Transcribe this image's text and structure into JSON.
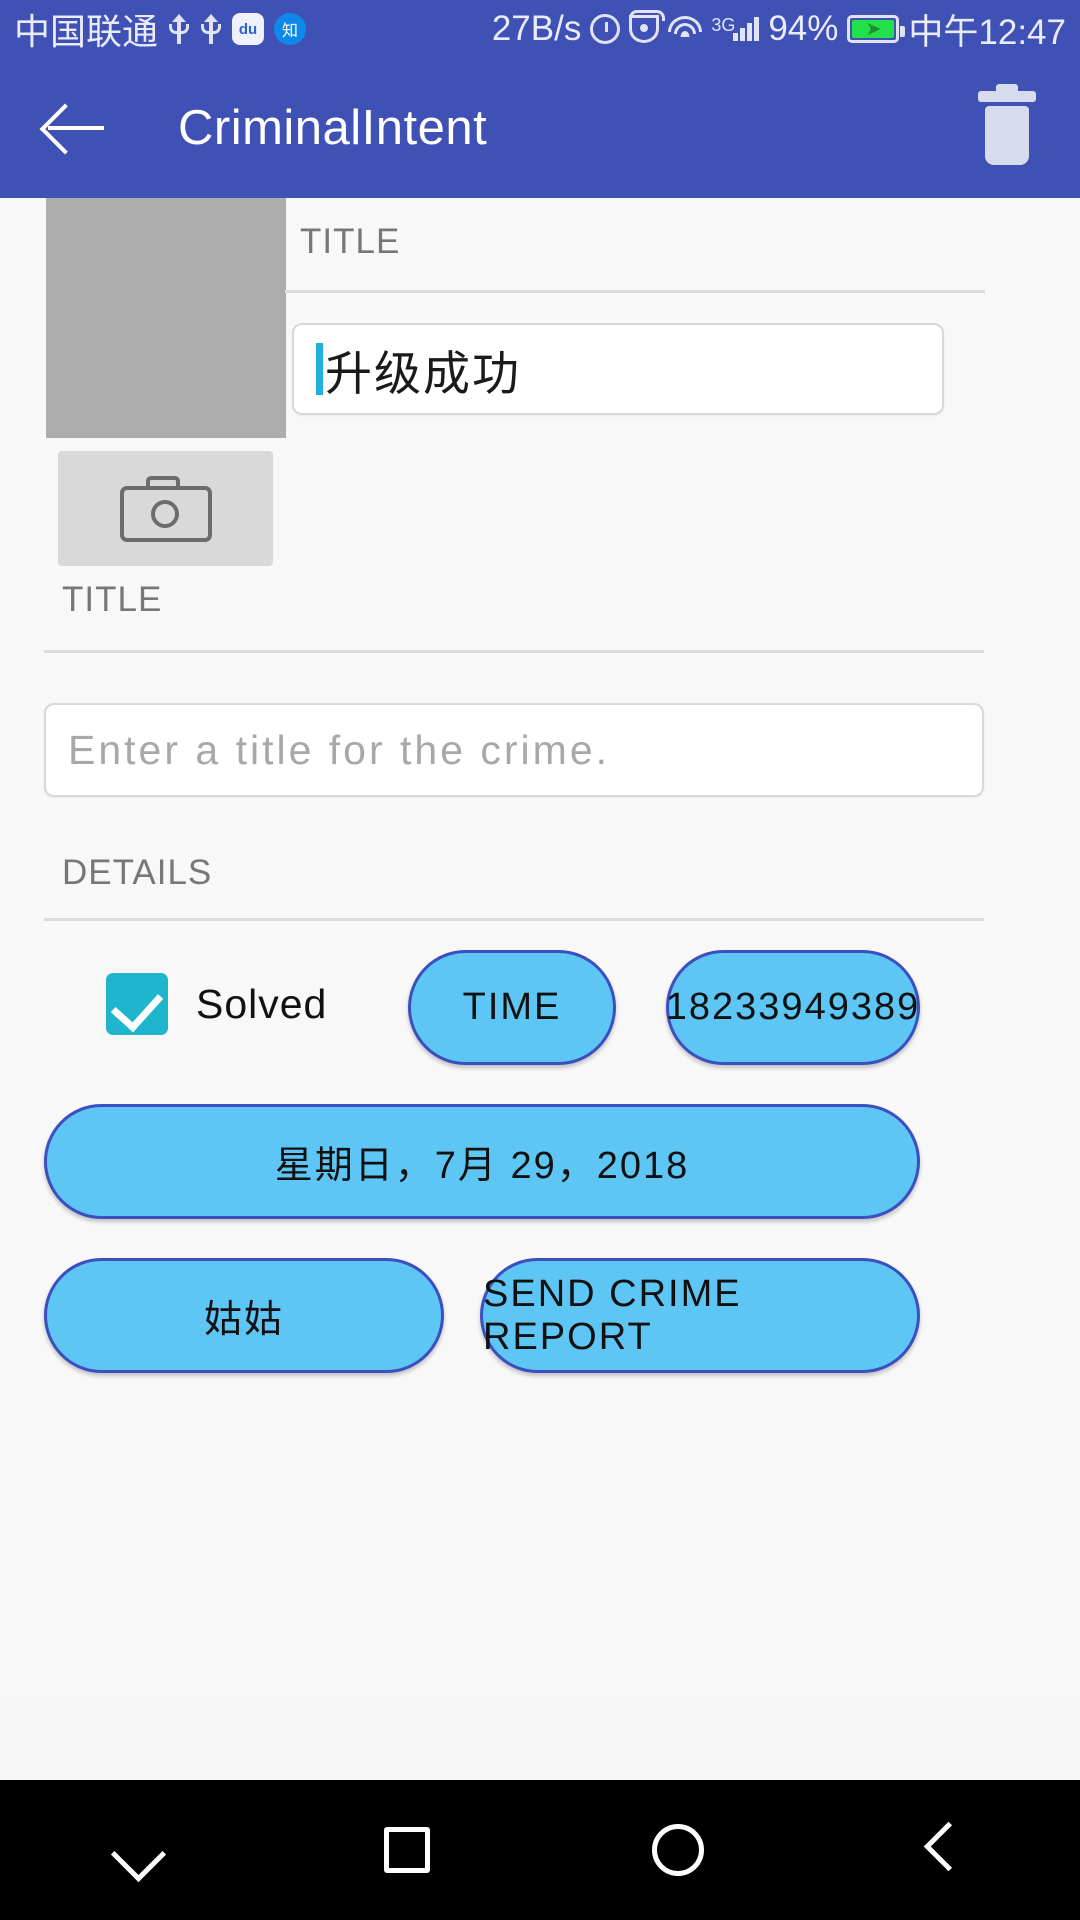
{
  "status_bar": {
    "carrier": "中国联通",
    "network_speed": "27B/s",
    "battery_percent": "94%",
    "clock": "中午12:47",
    "signal_type": "3G",
    "icons": [
      "usb-icon",
      "usb-icon",
      "baidu-icon",
      "zhihu-icon",
      "alarm-icon",
      "eye-care-icon",
      "wifi-icon",
      "signal-icon",
      "battery-charging-icon"
    ],
    "baidu_label": "du",
    "zhihu_label": "知"
  },
  "app_bar": {
    "title": "CriminalIntent",
    "back_icon": "back-arrow-icon",
    "delete_icon": "trash-icon"
  },
  "form": {
    "photo_placeholder": "crime-photo-placeholder",
    "camera_icon": "camera-icon",
    "title_label_top": "TITLE",
    "title_value": "升级成功",
    "title_label_second": "TITLE",
    "title_placeholder": "Enter a title for the crime.",
    "details_label": "DETAILS",
    "solved_label": "Solved",
    "solved_checked": true,
    "buttons": {
      "time": "TIME",
      "phone": "18233949389",
      "date": "星期日，7月 29，2018",
      "suspect": "姑姑",
      "report": "SEND CRIME REPORT"
    }
  },
  "nav_bar": {
    "items": [
      "chevron-down-icon",
      "recents-square-icon",
      "home-circle-icon",
      "back-triangle-icon"
    ]
  },
  "colors": {
    "primary": "#3f51b5",
    "button_fill": "#5ec6f5",
    "button_border": "#3b4fc0",
    "checkbox": "#1fb5cd",
    "cursor": "#23aee0"
  }
}
